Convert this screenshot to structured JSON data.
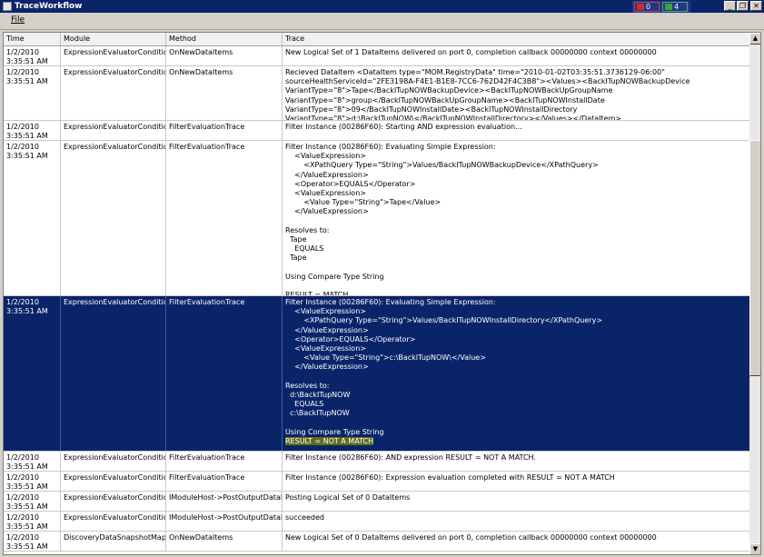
{
  "window": {
    "title": "TraceWorkflow",
    "error_count": "0",
    "ok_count": "4",
    "minimize_glyph": "_",
    "maximize_glyph": "❐",
    "close_glyph": "✕"
  },
  "menu": {
    "file_label": "File"
  },
  "table": {
    "columns": {
      "time": "Time",
      "module": "Module",
      "method": "Method",
      "trace": "Trace"
    },
    "rows": [
      {
        "time": "1/2/2010\n3:35:51 AM",
        "module": "ExpressionEvaluatorCondition",
        "method": "OnNewDataItems",
        "trace": "New Logical Set of 1 DataItems delivered on port 0, completion callback 00000000 context 00000000"
      },
      {
        "time": "1/2/2010\n3:35:51 AM",
        "module": "ExpressionEvaluatorCondition",
        "method": "OnNewDataItems",
        "trace": "Recieved DataItem <DataItem type=\"MOM.RegistryData\" time=\"2010-01-02T03:35:51.3736129-06:00\"\nsourceHealthServiceId=\"2FE3198A-F4E1-B1E8-7CC6-762D42F4C3B8\"><Values><BackITupNOWBackupDevice\nVariantType=\"8\">Tape</BackITupNOWBackupDevice><BackITupNOWBackUpGroupName\nVariantType=\"8\">group</BackITupNOWBackUpGroupName><BackITupNOWInstallDate\nVariantType=\"8\">09</BackITupNOWInstallDate><BackITupNOWInstallDirectory\nVariantType=\"8\">d:\\BackITupNOW\\</BackITupNOWInstallDirectory></Values></DataItem>"
      },
      {
        "time": "1/2/2010\n3:35:51 AM",
        "module": "ExpressionEvaluatorCondition",
        "method": "FilterEvaluationTrace",
        "trace": "Filter Instance (00286F60): Starting AND expression evaluation..."
      },
      {
        "time": "1/2/2010\n3:35:51 AM",
        "module": "ExpressionEvaluatorCondition",
        "method": "FilterEvaluationTrace",
        "trace": "Filter Instance (00286F60): Evaluating Simple Expression:\n    <ValueExpression>\n        <XPathQuery Type=\"String\">Values/BackITupNOWBackupDevice</XPathQuery>\n    </ValueExpression>\n    <Operator>EQUALS</Operator>\n    <ValueExpression>\n        <Value Type=\"String\">Tape</Value>\n    </ValueExpression>\n\nResolves to:\n  Tape\n    EQUALS\n  Tape\n\nUsing Compare Type String\n\nRESULT = MATCH"
      },
      {
        "time": "1/2/2010\n3:35:51 AM",
        "module": "ExpressionEvaluatorCondition",
        "method": "FilterEvaluationTrace",
        "trace": "Filter Instance (00286F60): Evaluating Simple Expression:\n    <ValueExpression>\n        <XPathQuery Type=\"String\">Values/BackITupNOWInstallDirectory</XPathQuery>\n    </ValueExpression>\n    <Operator>EQUALS</Operator>\n    <ValueExpression>\n        <Value Type=\"String\">c:\\BackITupNOW\\</Value>\n    </ValueExpression>\n\nResolves to:\n  d:\\BackITupNOW\n    EQUALS\n  c:\\BackITupNOW\n\nUsing Compare Type String\n",
        "trace_result": "RESULT = NOT A MATCH"
      },
      {
        "time": "1/2/2010\n3:35:51 AM",
        "module": "ExpressionEvaluatorCondition",
        "method": "FilterEvaluationTrace",
        "trace": "Filter Instance (00286F60): AND expression RESULT = NOT A MATCH."
      },
      {
        "time": "1/2/2010\n3:35:51 AM",
        "module": "ExpressionEvaluatorCondition",
        "method": "FilterEvaluationTrace",
        "trace": "Filter Instance (00286F60): Expression evaluation completed with RESULT = NOT A MATCH"
      },
      {
        "time": "1/2/2010\n3:35:51 AM",
        "module": "ExpressionEvaluatorCondition",
        "method": "IModuleHost->PostOutputDataItems",
        "trace": "Posting Logical Set of 0 DataItems"
      },
      {
        "time": "1/2/2010\n3:35:51 AM",
        "module": "ExpressionEvaluatorCondition",
        "method": "IModuleHost->PostOutputDataItems",
        "trace": "succeeded"
      },
      {
        "time": "1/2/2010\n3:35:51 AM",
        "module": "DiscoveryDataSnapshotMapper",
        "method": "OnNewDataItems",
        "trace": "New Logical Set of 0 DataItems delivered on port 0, completion callback 00000000 context 00000000"
      }
    ]
  },
  "scrollbar": {
    "up_glyph": "▲",
    "down_glyph": "▼"
  },
  "colors": {
    "titlebar": "#0a246a",
    "selection": "#0a246a",
    "highlight": "#5e6e1c"
  }
}
